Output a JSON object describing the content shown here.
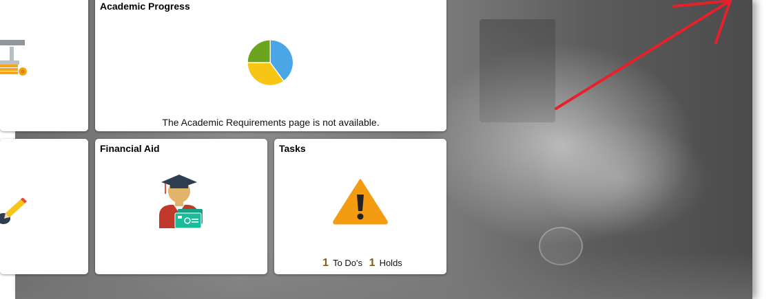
{
  "tiles": {
    "academic_progress": {
      "title": "Academic Progress",
      "message": "The Academic Requirements page is not available.",
      "icon": "pie-chart-icon",
      "colors": [
        "#4aa6e6",
        "#f6c516",
        "#6ba51f"
      ]
    },
    "financial_aid": {
      "title": "Financial Aid",
      "icon": "graduate-financial-aid-icon"
    },
    "tasks": {
      "title": "Tasks",
      "icon": "warning-icon",
      "todo_count": "1",
      "todo_label": "To Do's",
      "holds_count": "1",
      "holds_label": "Holds"
    },
    "left_top": {
      "icon": "bank-coins-icon"
    },
    "left_bottom": {
      "icon": "pencil-icon"
    }
  },
  "annotation": {
    "icon": "red-arrow-icon",
    "color": "#e8202a"
  }
}
